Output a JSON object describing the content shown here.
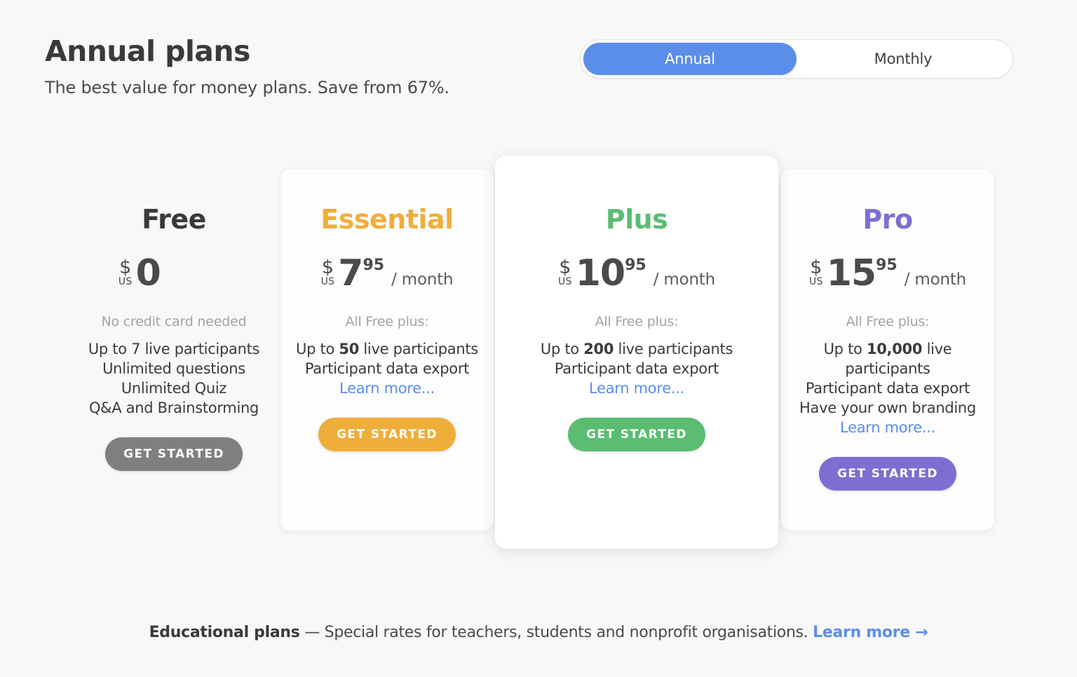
{
  "header": {
    "title": "Annual plans",
    "subtitle": "The best value for money plans. Save from 67%."
  },
  "billing_toggle": {
    "annual_label": "Annual",
    "monthly_label": "Monthly",
    "active": "Annual",
    "active_color": "#5b8ee8"
  },
  "plans": [
    {
      "name": "Free",
      "color": "#3a3a3a",
      "currency_symbol": "$",
      "currency_code": "US",
      "amount": "0",
      "cents": "",
      "period": "/ month",
      "period_visible": false,
      "note": "No credit card needed",
      "features": [
        {
          "prefix": "Up to 7 live participants",
          "bold": "",
          "suffix": ""
        },
        {
          "prefix": "Unlimited questions",
          "bold": "",
          "suffix": ""
        },
        {
          "prefix": "Unlimited Quiz",
          "bold": "",
          "suffix": ""
        },
        {
          "prefix": "Q&A and Brainstorming",
          "bold": "",
          "suffix": ""
        }
      ],
      "learn_more": "",
      "cta_label": "GET STARTED",
      "cta_color": "#7f7f7f",
      "featured": false,
      "has_card": false
    },
    {
      "name": "Essential",
      "color": "#efae3a",
      "currency_symbol": "$",
      "currency_code": "US",
      "amount": "7",
      "cents": "95",
      "period": "/ month",
      "period_visible": true,
      "note": "All Free plus:",
      "features": [
        {
          "prefix": "Up to ",
          "bold": "50",
          "suffix": " live participants"
        },
        {
          "prefix": "Participant data export",
          "bold": "",
          "suffix": ""
        }
      ],
      "learn_more": "Learn more...",
      "cta_label": "GET STARTED",
      "cta_color": "#efae3a",
      "featured": false,
      "has_card": true
    },
    {
      "name": "Plus",
      "color": "#5bbd72",
      "currency_symbol": "$",
      "currency_code": "US",
      "amount": "10",
      "cents": "95",
      "period": "/ month",
      "period_visible": true,
      "note": "All Free plus:",
      "features": [
        {
          "prefix": "Up to ",
          "bold": "200",
          "suffix": " live participants"
        },
        {
          "prefix": "Participant data export",
          "bold": "",
          "suffix": ""
        }
      ],
      "learn_more": "Learn more...",
      "cta_label": "GET STARTED",
      "cta_color": "#5bbd72",
      "featured": true,
      "has_card": true
    },
    {
      "name": "Pro",
      "color": "#7d6fd1",
      "currency_symbol": "$",
      "currency_code": "US",
      "amount": "15",
      "cents": "95",
      "period": "/ month",
      "period_visible": true,
      "note": "All Free plus:",
      "features": [
        {
          "prefix": "Up to ",
          "bold": "10,000",
          "suffix": " live participants"
        },
        {
          "prefix": "Participant data export",
          "bold": "",
          "suffix": ""
        },
        {
          "prefix": "Have your own branding",
          "bold": "",
          "suffix": ""
        }
      ],
      "learn_more": "Learn more...",
      "cta_label": "GET STARTED",
      "cta_color": "#7d6fd1",
      "featured": false,
      "has_card": true
    }
  ],
  "footer": {
    "title": "Educational plans",
    "separator": " — ",
    "description": "Special rates for teachers, students and nonprofit organisations. ",
    "link_label": "Learn more →"
  }
}
